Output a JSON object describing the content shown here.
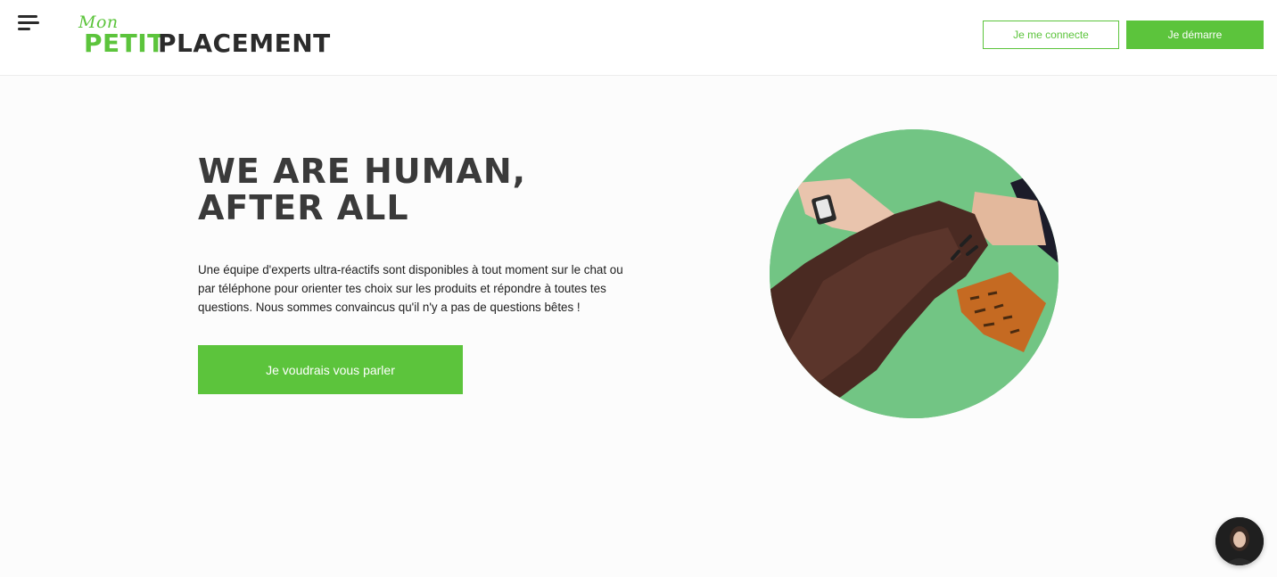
{
  "header": {
    "logo": {
      "mon": "Mon",
      "petit": "PETIT",
      "placement": "PLACEMENT"
    },
    "login_label": "Je me connecte",
    "start_label": "Je démarre"
  },
  "hero": {
    "title_line1": "WE ARE HUMAN,",
    "title_line2": "AFTER ALL",
    "text": "Une équipe d'experts ultra-réactifs sont disponibles à tout moment sur le chat ou par téléphone pour orienter tes choix sur les produits et répondre à toutes tes questions. Nous sommes convaincus qu'il n'y a pas de questions bêtes !",
    "cta_label": "Je voudrais vous parler"
  },
  "colors": {
    "brand_green": "#5cc43c",
    "dark_text": "#3a3a3a",
    "photo_background": "#6cc07c"
  },
  "icons": {
    "menu": "hamburger-menu-icon",
    "chat": "chat-avatar-icon"
  }
}
